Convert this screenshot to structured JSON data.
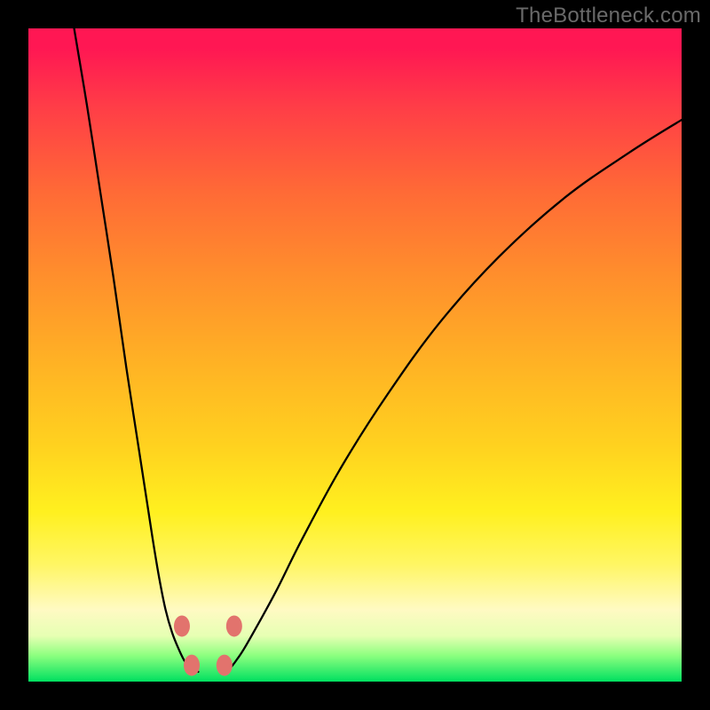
{
  "watermark": "TheBottleneck.com",
  "chart_data": {
    "type": "line",
    "title": "",
    "xlabel": "",
    "ylabel": "",
    "xlim": [
      0,
      100
    ],
    "ylim": [
      0,
      100
    ],
    "grid": false,
    "legend": false,
    "series": [
      {
        "name": "bottleneck-curve-left",
        "x": [
          7,
          9,
          11,
          13,
          15,
          17,
          19,
          20,
          21,
          22,
          23,
          24,
          25,
          26
        ],
        "values": [
          100,
          88,
          75,
          62,
          48,
          35,
          22,
          16,
          11,
          7.5,
          5,
          3,
          2,
          1.5
        ]
      },
      {
        "name": "bottleneck-curve-right",
        "x": [
          30,
          31,
          32,
          33,
          35,
          38,
          42,
          48,
          55,
          63,
          72,
          82,
          92,
          100
        ],
        "values": [
          1.5,
          2.2,
          3.5,
          5,
          8.5,
          14,
          22,
          33,
          44,
          55,
          65,
          74,
          81,
          86
        ]
      }
    ],
    "markers": [
      {
        "name": "marker-left-upper",
        "x": 23.5,
        "y": 8.5
      },
      {
        "name": "marker-left-lower",
        "x": 25.0,
        "y": 2.5
      },
      {
        "name": "marker-right-lower",
        "x": 30.0,
        "y": 2.5
      },
      {
        "name": "marker-right-upper",
        "x": 31.5,
        "y": 8.5
      }
    ],
    "background_gradient": {
      "stops": [
        {
          "pct": 0,
          "color": "#ff1753"
        },
        {
          "pct": 25,
          "color": "#ff6a36"
        },
        {
          "pct": 52,
          "color": "#ffb424"
        },
        {
          "pct": 74,
          "color": "#fff01f"
        },
        {
          "pct": 89,
          "color": "#fffac3"
        },
        {
          "pct": 96,
          "color": "#8dff7f"
        },
        {
          "pct": 100,
          "color": "#00e060"
        }
      ]
    }
  }
}
